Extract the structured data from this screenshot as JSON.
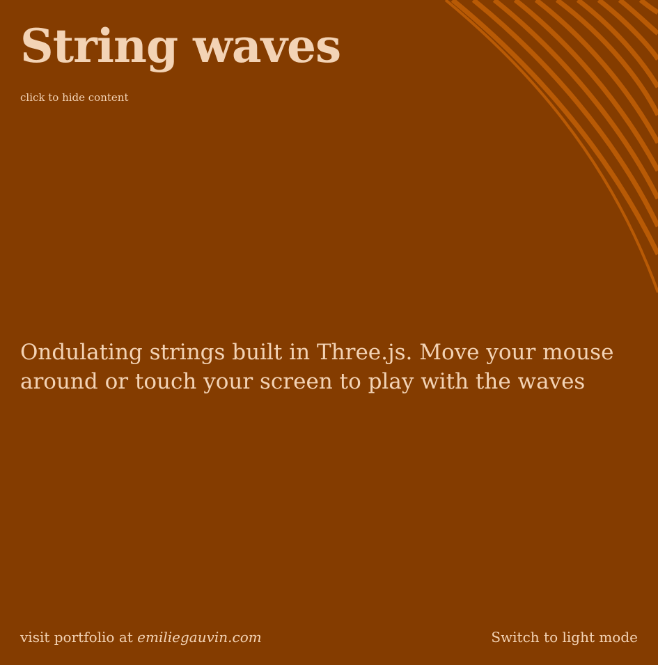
{
  "colors": {
    "background": "#843C00",
    "text": "#F3D3B5",
    "strings": "#B85A05"
  },
  "header": {
    "title": "String waves",
    "hide_toggle": "click to hide content"
  },
  "main": {
    "description": "Ondulating strings built in Three.js. Move your mouse around or touch your screen to play with the waves"
  },
  "footer": {
    "portfolio_prefix": "visit portfolio at",
    "portfolio_link": "emiliegauvin.com",
    "theme_toggle": "Switch to light mode"
  }
}
